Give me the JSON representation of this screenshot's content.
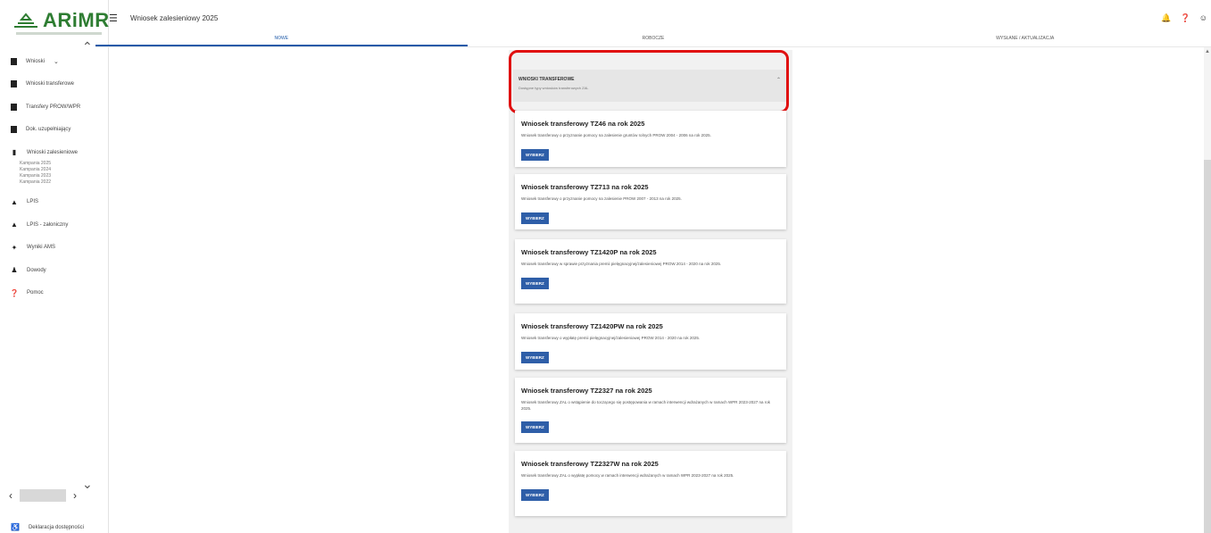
{
  "app": {
    "logo_text": "ARiMR",
    "title": "Wniosek zalesieniowy 2025"
  },
  "sidebar": {
    "items": [
      {
        "label": "Wnioski",
        "icon": "folder-icon",
        "has_chevron": true
      },
      {
        "label": "Wnioski transferowe",
        "icon": "folder-icon"
      },
      {
        "label": "Transfery PROW/WPR",
        "icon": "folder-icon"
      },
      {
        "label": "Dok. uzupełniający",
        "icon": "folder-icon"
      },
      {
        "label": "Wnioski zalesieniowe",
        "icon": "tree-icon"
      }
    ],
    "campaigns": [
      "Kampania 2025",
      "Kampania 2024",
      "Kampania 2023",
      "Kampania 2022"
    ],
    "items2": [
      {
        "label": "LPIS",
        "icon": "mountain-icon"
      },
      {
        "label": "LPIS - załoniczny",
        "icon": "mountain-icon"
      },
      {
        "label": "Wyniki AMS",
        "icon": "satellite-icon"
      },
      {
        "label": "Dowody",
        "icon": "person-icon"
      },
      {
        "label": "Pomoc",
        "icon": "help-icon"
      }
    ],
    "footer_label": "Deklaracja dostępności"
  },
  "tabs": [
    "NOWE",
    "ROBOCZE",
    "WYSŁANE / AKTUALIZACJA"
  ],
  "section": {
    "title": "WNIOSKI TRANSFEROWE",
    "subtitle": "Dostępne typy wniosków transferowych ZAL"
  },
  "cards": [
    {
      "title": "Wniosek transferowy TZ46 na rok 2025",
      "desc": "Wniosek transferowy o przyznanie pomocy na zalesienie gruntów rolnych PROW 2004 - 2006 na rok 2025.",
      "button": "WYBIERZ"
    },
    {
      "title": "Wniosek transferowy TZ713 na rok 2025",
      "desc": "Wniosek transferowy o przyznanie pomocy na zalesienie PROW 2007 - 2013 na rok 2025.",
      "button": "WYBIERZ"
    },
    {
      "title": "Wniosek transferowy TZ1420P na rok 2025",
      "desc": "Wniosek transferowy w sprawie przyznania premii pielęgnacyjnej/zalesieniowej PROW 2014 - 2020 na rok 2025.",
      "button": "WYBIERZ"
    },
    {
      "title": "Wniosek transferowy TZ1420PW na rok 2025",
      "desc": "Wniosek transferowy o wypłatę premii pielęgnacyjnej/zalesieniowej PROW 2014 - 2020 na rok 2025.",
      "button": "WYBIERZ"
    },
    {
      "title": "Wniosek transferowy TZ2327 na rok 2025",
      "desc": "Wniosek transferowy ZAL o wstąpienie do toczącego się postępowania w ramach interwencji wdrażanych w ramach WPR 2023-2027 na rok 2025.",
      "button": "WYBIERZ"
    },
    {
      "title": "Wniosek transferowy TZ2327W na rok 2025",
      "desc": "Wniosek transferowy ZAL o wypłatę pomocy w ramach interwencji wdrażanych w ramach WPR 2023-2027 na rok 2025.",
      "button": "WYBIERZ"
    }
  ],
  "colors": {
    "accent": "#2e5ea8",
    "highlight": "#e01010",
    "logo": "#2e7d32"
  }
}
